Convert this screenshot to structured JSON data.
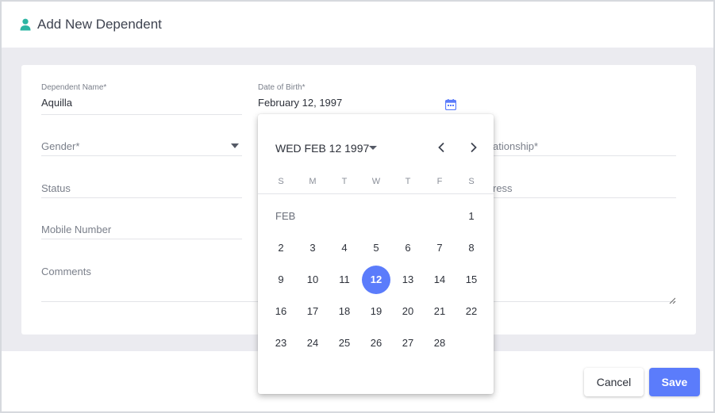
{
  "header": {
    "title": "Add New Dependent",
    "icon": "person-icon"
  },
  "form": {
    "dependent_name": {
      "label": "Dependent Name*",
      "value": "Aquilla"
    },
    "date_of_birth": {
      "label": "Date of Birth*",
      "value": "February 12, 1997"
    },
    "gender": {
      "placeholder": "Gender*"
    },
    "relationship": {
      "placeholder_partial": "ationship*"
    },
    "status": {
      "placeholder": "Status"
    },
    "address": {
      "placeholder_partial": "ress"
    },
    "mobile_number": {
      "placeholder": "Mobile Number"
    },
    "comments": {
      "placeholder": "Comments"
    }
  },
  "datepicker": {
    "header": "WED FEB 12 1997",
    "weekdays": [
      "S",
      "M",
      "T",
      "W",
      "T",
      "F",
      "S"
    ],
    "month_label": "FEB",
    "days": [
      "1",
      "2",
      "3",
      "4",
      "5",
      "6",
      "7",
      "8",
      "9",
      "10",
      "11",
      "12",
      "13",
      "14",
      "15",
      "16",
      "17",
      "18",
      "19",
      "20",
      "21",
      "22",
      "23",
      "24",
      "25",
      "26",
      "27",
      "28"
    ],
    "selected_day": "12",
    "first_weekday_index": 6
  },
  "footer": {
    "cancel_label": "Cancel",
    "save_label": "Save"
  },
  "colors": {
    "accent": "#5b7cfb",
    "icon_teal": "#2db5a3",
    "background": "#ebebf0"
  }
}
